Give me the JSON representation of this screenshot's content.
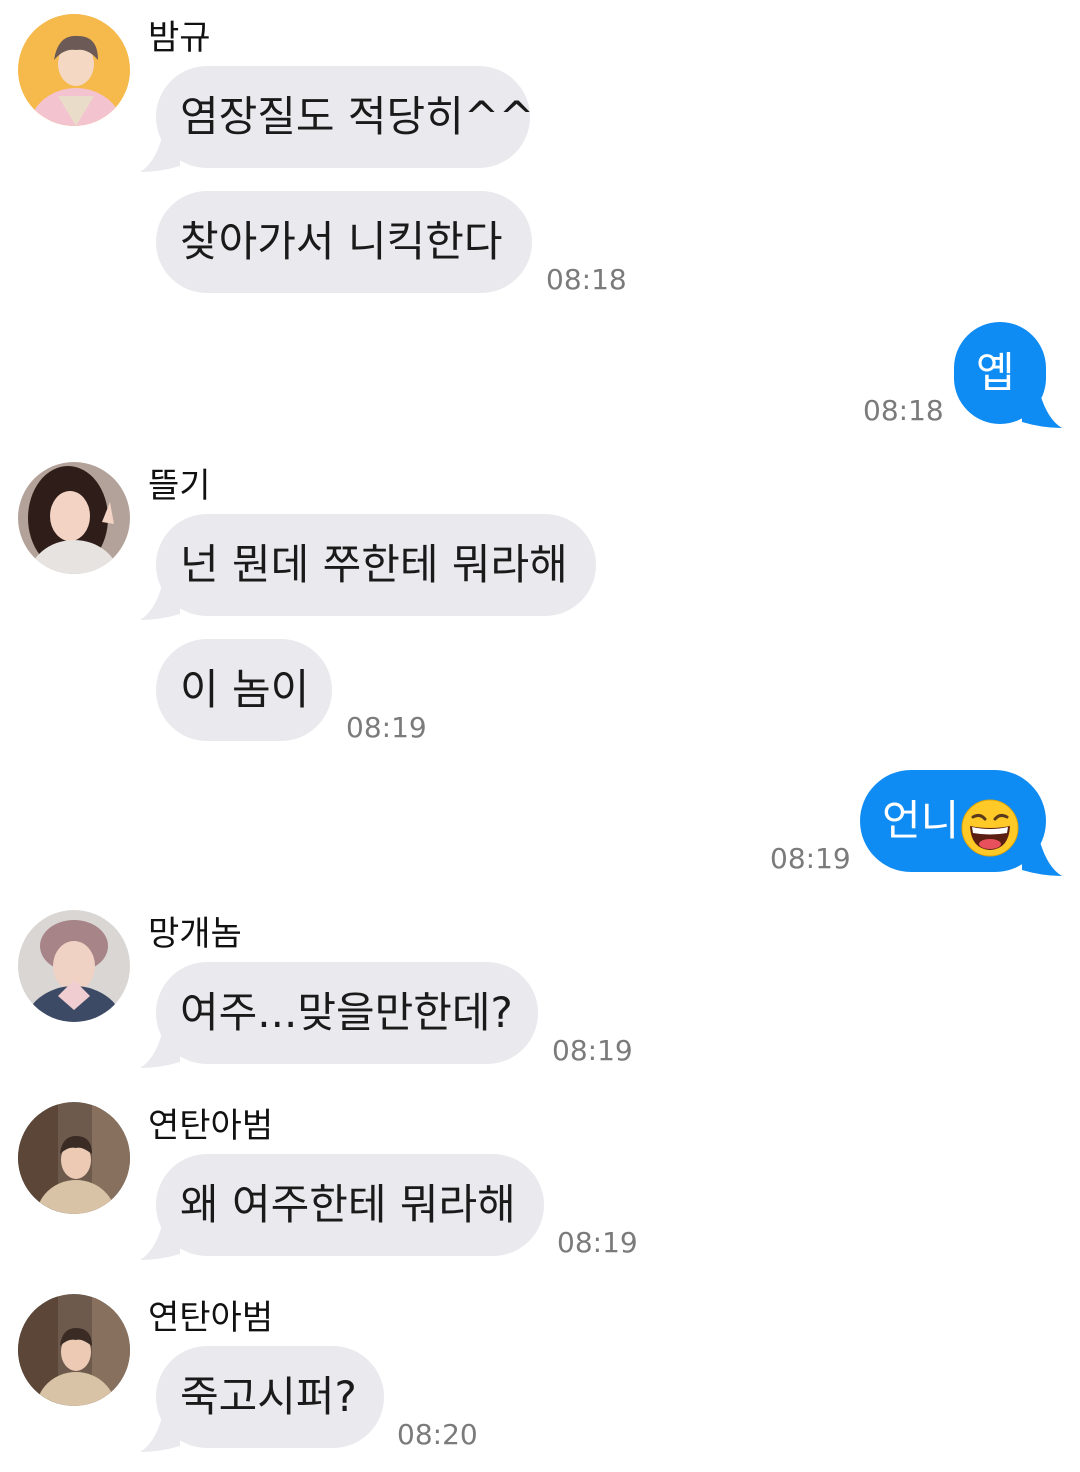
{
  "colors": {
    "incoming_bubble": "#e9e9ee",
    "outgoing_bubble": "#0f8cf3",
    "timestamp": "#7b7b7b"
  },
  "groups": [
    {
      "sender": "밤규",
      "avatar_icon": "avatar-photo",
      "messages": [
        "염장질도 적당히^^",
        "찾아가서 니킥한다"
      ],
      "time": "08:18"
    },
    {
      "outgoing": true,
      "messages": [
        "옙"
      ],
      "time": "08:18"
    },
    {
      "sender": "뜰기",
      "avatar_icon": "avatar-photo",
      "messages": [
        "넌 뭔데 쭈한테 뭐라해",
        "이 놈이"
      ],
      "time": "08:19"
    },
    {
      "outgoing": true,
      "messages": [
        "언니"
      ],
      "emoji": "grinning-squinting-face-icon",
      "time": "08:19"
    },
    {
      "sender": "망개놈",
      "avatar_icon": "avatar-photo",
      "messages": [
        "여주...맞을만한데?"
      ],
      "time": "08:19"
    },
    {
      "sender": "연탄아범",
      "avatar_icon": "avatar-photo",
      "messages": [
        "왜 여주한테 뭐라해"
      ],
      "time": "08:19"
    },
    {
      "sender": "연탄아범",
      "avatar_icon": "avatar-photo",
      "messages": [
        "죽고시퍼?"
      ],
      "time": "08:20"
    }
  ]
}
